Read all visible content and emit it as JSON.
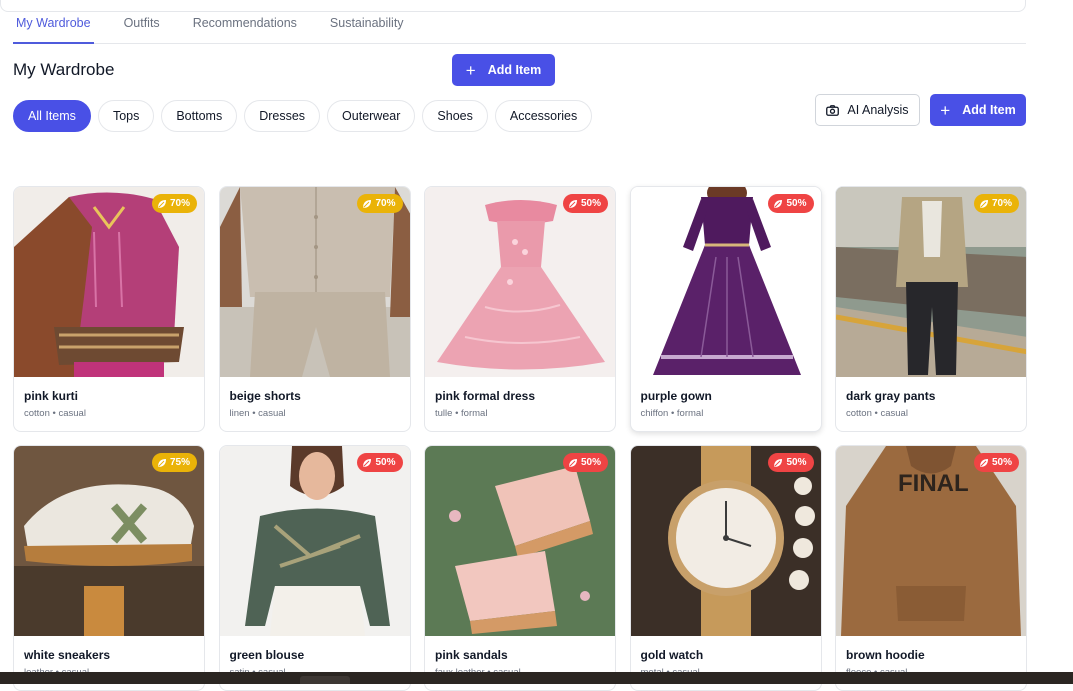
{
  "tabs": [
    "My Wardrobe",
    "Outfits",
    "Recommendations",
    "Sustainability"
  ],
  "page_title": "My Wardrobe",
  "add_item_label": "Add Item",
  "ai_analysis_label": "AI Analysis",
  "filters": [
    "All Items",
    "Tops",
    "Bottoms",
    "Dresses",
    "Outerwear",
    "Shoes",
    "Accessories"
  ],
  "colors": {
    "accent": "#4950e6",
    "badge_yellow": "#eab308",
    "badge_red": "#ef4444"
  },
  "items": [
    {
      "name": "pink kurti",
      "meta": "cotton • casual",
      "score": "70%",
      "badge_color": "yellow",
      "image": "woman in magenta patterned kurti with brown shawl"
    },
    {
      "name": "beige shorts",
      "meta": "linen • casual",
      "score": "70%",
      "badge_color": "yellow",
      "image": "man in beige linen shirt and trousers"
    },
    {
      "name": "pink formal dress",
      "meta": "tulle • formal",
      "score": "50%",
      "badge_color": "red",
      "image": "pink tulle gown on mannequin"
    },
    {
      "name": "purple gown",
      "meta": "chiffon • formal",
      "score": "50%",
      "badge_color": "red",
      "image": "girl in purple embroidered gown"
    },
    {
      "name": "dark gray pants",
      "meta": "cotton • casual",
      "score": "70%",
      "badge_color": "yellow",
      "image": "man on railway platform in beige jacket and dark pants"
    },
    {
      "name": "white sneakers",
      "meta": "leather • casual",
      "score": "75%",
      "badge_color": "yellow",
      "image": "white sneakers with green X"
    },
    {
      "name": "green blouse",
      "meta": "satin • casual",
      "score": "50%",
      "badge_color": "red",
      "image": "woman in printed crop blouse"
    },
    {
      "name": "pink sandals",
      "meta": "faux leather • casual",
      "score": "50%",
      "badge_color": "red",
      "image": "pink platform sandals on green background"
    },
    {
      "name": "gold watch",
      "meta": "metal • casual",
      "score": "50%",
      "badge_color": "red",
      "image": "gold wristwatch with pearls"
    },
    {
      "name": "brown hoodie",
      "meta": "fleece • casual",
      "score": "50%",
      "badge_color": "red",
      "image": "brown hoodie with FINAL print"
    }
  ]
}
